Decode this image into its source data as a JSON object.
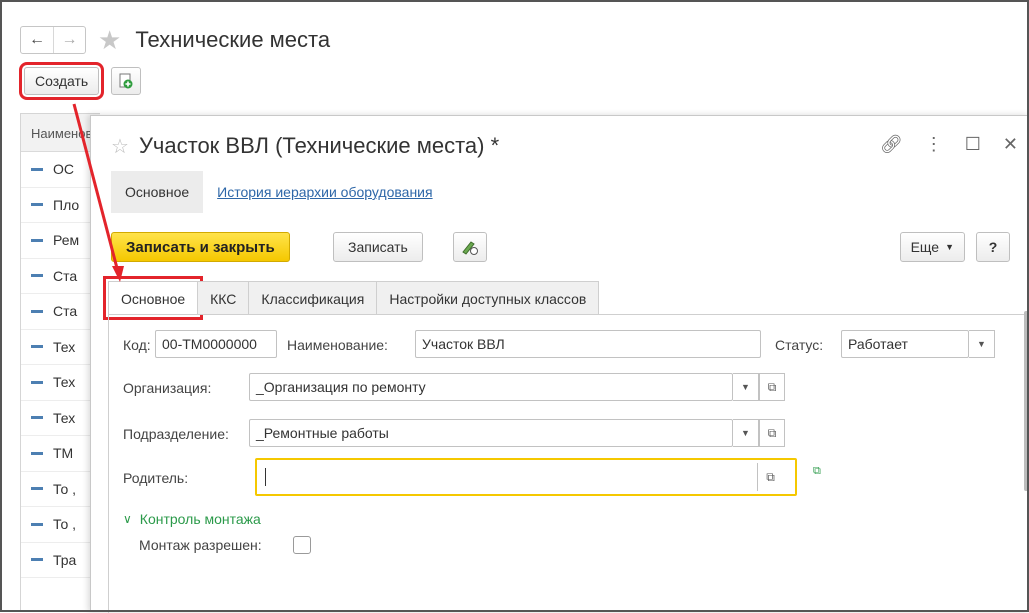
{
  "background_window": {
    "title": "Технические места",
    "nav_back": "←",
    "nav_forward": "→",
    "create_button": "Создать",
    "table_header": "Наименование",
    "rows": [
      "ОС",
      "Пло",
      "Рем",
      "Ста",
      "Ста",
      "Тех",
      "Тех",
      "Тех",
      "ТМ",
      "То ,",
      "То ,",
      "Тра"
    ]
  },
  "form": {
    "title": "Участок ВВЛ (Технические места) *",
    "nav_tabs": {
      "main": "Основное",
      "history_link": "История иерархии оборудования"
    },
    "commands": {
      "save_close": "Записать и закрыть",
      "save": "Записать",
      "more": "Еще",
      "help": "?"
    },
    "tabs": [
      "Основное",
      "ККС",
      "Классификация",
      "Настройки доступных классов"
    ],
    "fields": {
      "code_label": "Код:",
      "code_value": "00-ТМ0000000",
      "name_label": "Наименование:",
      "name_value": "Участок ВВЛ",
      "status_label": "Статус:",
      "status_value": "Работает",
      "org_label": "Организация:",
      "org_value": "_Организация по ремонту",
      "division_label": "Подразделение:",
      "division_value": "_Ремонтные работы",
      "parent_label": "Родитель:",
      "parent_value": ""
    },
    "assembly_group": {
      "label": "Контроль монтажа",
      "allowed_label": "Монтаж разрешен:"
    }
  },
  "colors": {
    "accent_yellow": "#f5c800",
    "highlight_red": "#e3242b",
    "link_blue": "#2e67a8",
    "group_green": "#2b9a4a"
  }
}
